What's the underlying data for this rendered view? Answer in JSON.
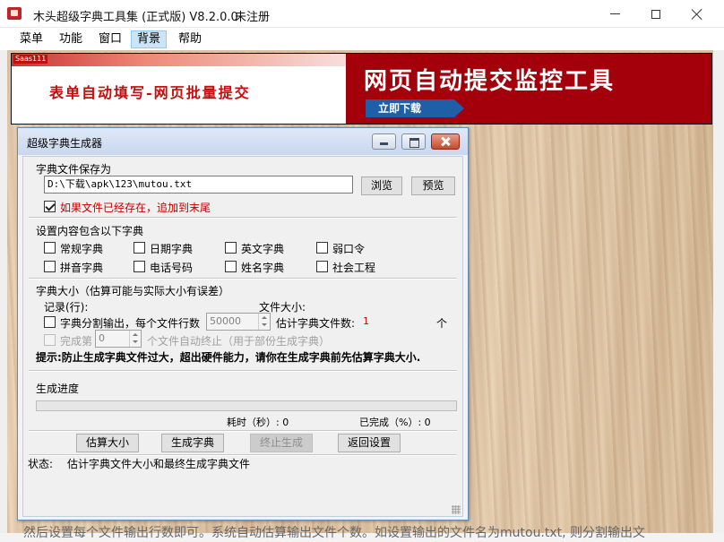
{
  "window": {
    "title": "木头超级字典工具集 (正式版) V8.2.0.0",
    "status": "未注册"
  },
  "menu": [
    "菜单",
    "功能",
    "窗口",
    "背景",
    "帮助"
  ],
  "menu_active": "背景",
  "banner": {
    "tag": "Saas111",
    "left_text": "表单自动填写-网页批量提交",
    "right_text": "网页自动提交监控工具",
    "cta": "立即下载",
    "colors": {
      "left": "#c40d0d",
      "right_bg": "#a3000b",
      "cta_bg": "#1f5fa8"
    }
  },
  "background_text": "然后设置每个文件输出行数即可。系统自动估算输出文件个数。如设置输出的文件名为mutou.txt, 则分割输出文",
  "dialog": {
    "title": "超级字典生成器",
    "save_section": {
      "label": "字典文件保存为",
      "path": "D:\\下载\\apk\\123\\mutou.txt",
      "browse": "浏览",
      "preview": "预览",
      "append_label": "如果文件已经存在，追加到末尾",
      "append_checked": true
    },
    "content_section": {
      "label": "设置内容包含以下字典",
      "options": [
        {
          "label": "常规字典",
          "checked": false
        },
        {
          "label": "日期字典",
          "checked": false
        },
        {
          "label": "英文字典",
          "checked": false
        },
        {
          "label": "弱口令",
          "checked": false
        },
        {
          "label": "拼音字典",
          "checked": false
        },
        {
          "label": "电话号码",
          "checked": false
        },
        {
          "label": "姓名字典",
          "checked": false
        },
        {
          "label": "社会工程",
          "checked": false
        }
      ]
    },
    "size_section": {
      "label": "字典大小（估算可能与实际大小有误差）",
      "records_label": "记录(行):",
      "filesize_label": "文件大小:",
      "split_label": "字典分割输出，每个文件行数",
      "split_value": "50000",
      "estimate_label": "估计字典文件数:",
      "estimate_value": "1",
      "unit": "个",
      "complete_prefix": "完成第",
      "complete_value": "0",
      "complete_suffix": "个文件自动终止（用于部份生成字典）",
      "tip": "提示:防止生成字典文件过大，超出硬件能力，请你在生成字典前先估算字典大小."
    },
    "progress_section": {
      "label": "生成进度",
      "progress": 0,
      "elapsed": "耗时（秒）: 0",
      "percent": "已完成（%）: 0"
    },
    "buttons": {
      "estimate": "估算大小",
      "generate": "生成字典",
      "stop": "终止生成",
      "back": "返回设置"
    },
    "status": {
      "label": "状态:",
      "text": "估计字典文件大小和最终生成字典文件"
    }
  }
}
